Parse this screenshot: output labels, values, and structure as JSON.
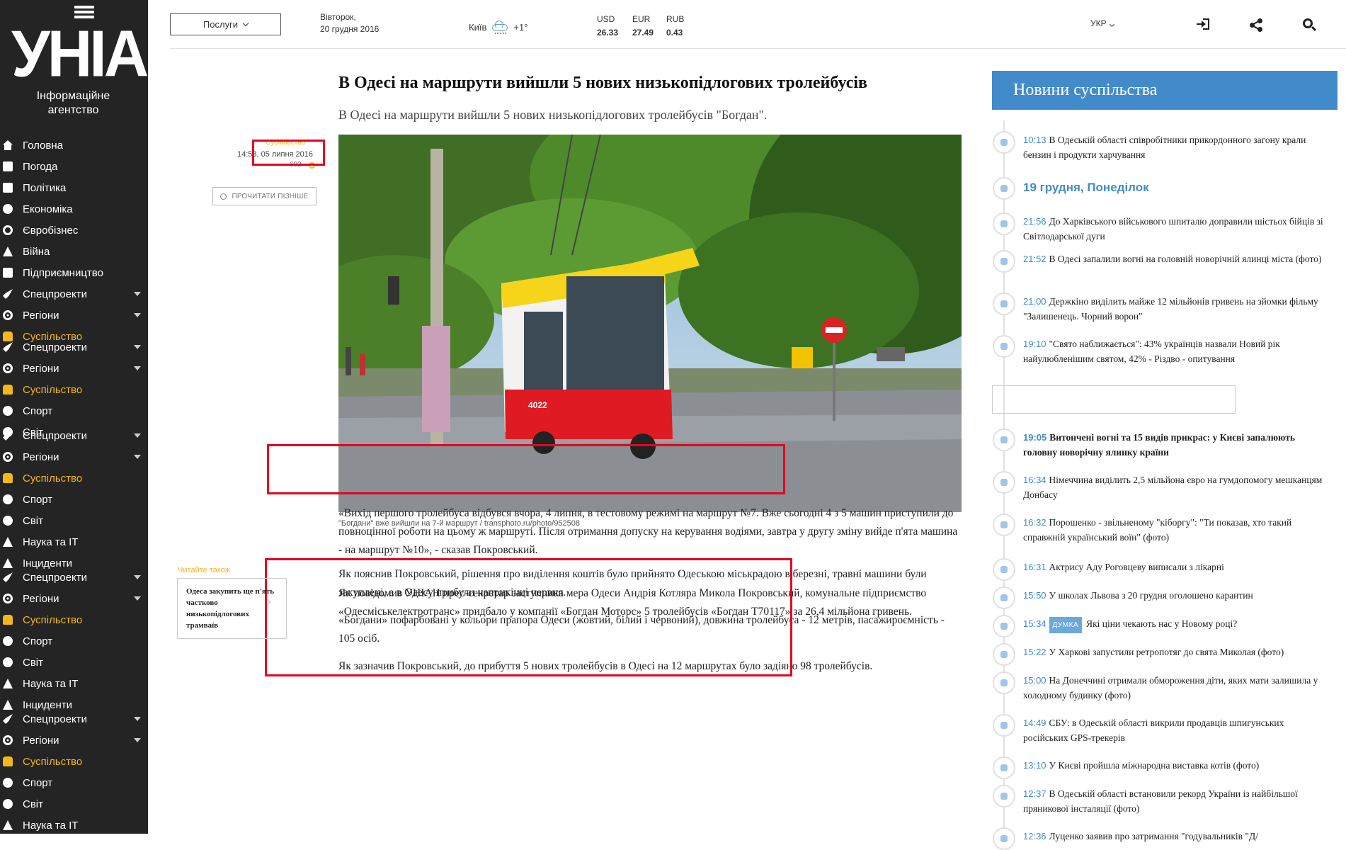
{
  "sidebar": {
    "logo": "УНІАН",
    "logo_sub": "Інформаційне агентство",
    "items": [
      {
        "label": "Головна",
        "icon": "home-icon",
        "active": false
      },
      {
        "label": "Погода",
        "icon": "weather-icon",
        "active": false
      },
      {
        "label": "Політика",
        "icon": "politics-icon",
        "active": false
      },
      {
        "label": "Економіка",
        "icon": "economy-icon",
        "active": false
      },
      {
        "label": "Євробізнес",
        "icon": "eurobusiness-icon",
        "active": false
      },
      {
        "label": "Війна",
        "icon": "war-icon",
        "active": false
      },
      {
        "label": "Підприємництво",
        "icon": "handshake-icon",
        "active": false
      },
      {
        "label": "Спецпроекти",
        "icon": "rocket-icon",
        "active": false,
        "caret": true
      },
      {
        "label": "Регіони",
        "icon": "regions-icon",
        "active": false,
        "caret": true
      },
      {
        "label": "Суспільство",
        "icon": "society-icon",
        "active": true
      },
      {
        "label": "Спецпроекти",
        "icon": "rocket-icon",
        "active": false,
        "caret": true
      },
      {
        "label": "Регіони",
        "icon": "regions-icon",
        "active": false,
        "caret": true
      },
      {
        "label": "Суспільство",
        "icon": "society-icon",
        "active": true
      },
      {
        "label": "Спорт",
        "icon": "sport-icon",
        "active": false
      },
      {
        "label": "Світ",
        "icon": "world-icon",
        "active": false
      },
      {
        "label": "Спецпроекти",
        "icon": "rocket-icon",
        "active": false,
        "caret": true
      },
      {
        "label": "Регіони",
        "icon": "regions-icon",
        "active": false,
        "caret": true
      },
      {
        "label": "Суспільство",
        "icon": "society-icon",
        "active": true
      },
      {
        "label": "Спорт",
        "icon": "sport-icon",
        "active": false
      },
      {
        "label": "Світ",
        "icon": "world-icon",
        "active": false
      },
      {
        "label": "Наука та IT",
        "icon": "science-icon",
        "active": false
      },
      {
        "label": "Інциденти",
        "icon": "incidents-icon",
        "active": false
      },
      {
        "label": "Спецпроекти",
        "icon": "rocket-icon",
        "active": false,
        "caret": true
      },
      {
        "label": "Регіони",
        "icon": "regions-icon",
        "active": false,
        "caret": true
      },
      {
        "label": "Суспільство",
        "icon": "society-icon",
        "active": true
      },
      {
        "label": "Спорт",
        "icon": "sport-icon",
        "active": false
      },
      {
        "label": "Світ",
        "icon": "world-icon",
        "active": false
      },
      {
        "label": "Наука та IT",
        "icon": "science-icon",
        "active": false
      },
      {
        "label": "Інциденти",
        "icon": "incidents-icon",
        "active": false
      },
      {
        "label": "Спецпроекти",
        "icon": "rocket-icon",
        "active": false,
        "caret": true
      },
      {
        "label": "Регіони",
        "icon": "regions-icon",
        "active": false,
        "caret": true
      },
      {
        "label": "Суспільство",
        "icon": "society-icon",
        "active": true
      },
      {
        "label": "Спорт",
        "icon": "sport-icon",
        "active": false
      },
      {
        "label": "Світ",
        "icon": "world-icon",
        "active": false
      },
      {
        "label": "Наука та IT",
        "icon": "science-icon",
        "active": false
      }
    ]
  },
  "topbar": {
    "services_label": "Послуги",
    "date_line1": "Вівторок,",
    "date_line2": "20 грудня 2016",
    "city": "Київ",
    "temperature": "+1°",
    "currencies": [
      {
        "code": "USD",
        "value": "26.33"
      },
      {
        "code": "EUR",
        "value": "27.49"
      },
      {
        "code": "RUB",
        "value": "0.43"
      }
    ],
    "language": "УКР"
  },
  "article": {
    "title": "В Одесі на маршрути вийшли 5 нових низькопідлогових тролейбусів",
    "lead": "В Одесі на маршрути вийшли 5 нових низькопідлогових тролейбусів \"Богдан\".",
    "category": "Суспільство",
    "time": "14:58, 05 липня 2016",
    "views": "692",
    "read_later": "ПРОЧИТАТИ ПІЗНІШЕ",
    "photo_caption": "\"Богдани\" вже вийшли на 7-й маршрут / transphoto.ru/photo/952508",
    "bus_number": "4022",
    "paragraphs": [
      "Як повідомив УНІАН прес-секретар заступника мера Одеси Андрія Котляра Микола Покровський, комунальне підприємство «Одесміськелектротранс» придбало у компанії «Богдан Моторс» 5 тролейбусів «Богдан Т70117» за 26,4 мільйона гривень.",
      "«Вихід першого тролейбуса відбувся вчора, 4 липня, в тестовому режимі на маршрут №7. Вже сьогодні 4 з 5 машин приступили до повноцінної роботи на цьому ж маршруті. Після отримання допуску на керування водіями, завтра у другу зміну вийде п'ята машина - на маршрут №10», - сказав Покровський.",
      "Як пояснив Покровський, рішення про виділення коштів було прийнято Одеською міськрадою в березні, травні машини були закуплені, а в Одесу прибули наприкінці червня.",
      "«Богдани» пофарбовані у кольори прапора Одеси (жовтий, білий і червоний), довжина тролейбуса - 12 метрів, пасажироємність - 105 осіб.",
      "Як зазначив Покровський, до прибуття 5 нових тролейбусів в Одесі на 12 маршрутах було задіяно 98 тролейбусів."
    ],
    "read_also_label": "Читайте також",
    "read_also_title": "Одеса закупить ще п'ять частково низькопідлогових трамваїв"
  },
  "right": {
    "header": "Новини суспільства",
    "day_header": "19 грудня, Понеділок",
    "news": [
      {
        "time": "10:13",
        "text": "В Одеській області співробітники прикордонного загону крали бензин і продукти харчування",
        "icon": "people-icon",
        "bold": false
      },
      {
        "time": "21:56",
        "text": "До Харківського військового шпиталю доправили шістьох бійців зі Світлодарської дуги",
        "icon": "video-icon",
        "bold": false
      },
      {
        "time": "21:52",
        "text": "В Одесі запалили вогні на головній новорічній ялинці міста (фото)",
        "icon": "camera-icon",
        "bold": false
      },
      {
        "time": "21:00",
        "text": "Держкіно виділить майже 12 мільйонів гривень на зйомки фільму \"Залишенець. Чорний ворон\"",
        "icon": "people-icon",
        "bold": false
      },
      {
        "time": "19:10",
        "text": "\"Свято наближається\": 43% українців назвали Новий рік найулюбленішим святом, 42% - Різдво - опитування",
        "icon": "people-icon",
        "bold": false
      },
      {
        "time": "19:05",
        "text": "Витончені вогні та 15 видів прикрас: у Києві запалюють головну новорічну ялинку країни",
        "icon": "people-icon",
        "bold": true
      },
      {
        "time": "16:34",
        "text": "Німеччина виділить 2,5 мільйона євро на гумдопомогу мешканцям Донбасу",
        "icon": "people-icon",
        "bold": false
      },
      {
        "time": "16:32",
        "text": "Порошенко - звільненому \"кіборгу\": \"Ти показав, хто такий справжній український воїн\" (фото)",
        "icon": "video-icon",
        "bold": false
      },
      {
        "time": "16:31",
        "text": "Актрису Аду Роговцеву виписали з лікарні",
        "icon": "people-icon",
        "bold": false
      },
      {
        "time": "15:50",
        "text": "У школах Львова з 20 грудня оголошено карантин",
        "icon": "people-icon",
        "bold": false
      },
      {
        "time": "15:34",
        "badge": "ДУМКА",
        "text": "Які ціни чекають нас у Новому році?",
        "icon": "people-icon",
        "bold": false
      },
      {
        "time": "15:22",
        "text": "У Харкові запустили ретропотяг до свята Миколая (фото)",
        "icon": "people-icon",
        "bold": false
      },
      {
        "time": "15:00",
        "text": "На Донеччині отримали обмороження діти, яких мати залишила у холодному будинку (фото)",
        "icon": "people-icon",
        "bold": false
      },
      {
        "time": "14:49",
        "text": "СБУ: в Одеській області викрили продавців шпигунських російських GPS-трекерів",
        "icon": "people-icon",
        "bold": false
      },
      {
        "time": "13:10",
        "text": "У Києві пройшла міжнародна виставка котів (фото)",
        "icon": "camera-icon",
        "bold": false
      },
      {
        "time": "12:37",
        "text": "В Одеській області встановили рекорд України із найбільшої пряникової інсталяції (фото)",
        "icon": "people-icon",
        "bold": false
      },
      {
        "time": "12:36",
        "text": "Луценко заявив про затримання \"годувальників \"Д/",
        "icon": "people-icon",
        "bold": false
      }
    ]
  }
}
